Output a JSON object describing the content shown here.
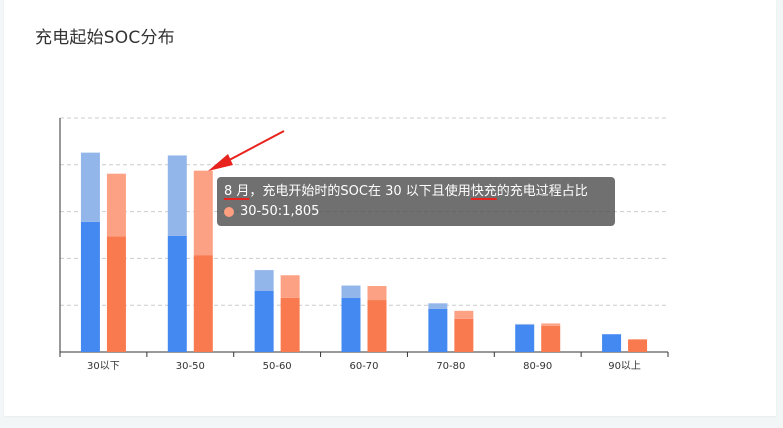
{
  "title": "充电起始SOC分布",
  "tooltip": {
    "month": "8 月",
    "text_mid": "，充电开始时的SOC在 30 以下且使用",
    "text_mark": "快充",
    "text_end": "的充电过程占比",
    "series_color": "#ff9f80",
    "category": "30-50",
    "value_text": "1,805",
    "separator": ": "
  },
  "colors": {
    "blue_base": "#4389f1",
    "blue_top": "#92b5ea",
    "orange_base": "#f97a4f",
    "orange_top": "#fca184",
    "annotation": "#e8231e"
  },
  "chart_data": {
    "type": "bar",
    "stacked": true,
    "categories": [
      "30以下",
      "30-50",
      "50-60",
      "60-70",
      "70-80",
      "80-90",
      "90以上"
    ],
    "series": [
      {
        "group": "blue",
        "layer": "base",
        "values": [
          2780,
          2480,
          1310,
          1160,
          920,
          580,
          380
        ]
      },
      {
        "group": "blue",
        "layer": "top",
        "values": [
          1480,
          1720,
          440,
          260,
          120,
          20,
          0
        ]
      },
      {
        "group": "orange",
        "layer": "base",
        "values": [
          2470,
          2070,
          1160,
          1110,
          710,
          560,
          270
        ]
      },
      {
        "group": "orange",
        "layer": "top",
        "values": [
          1340,
          1805,
          480,
          300,
          170,
          50,
          0
        ]
      }
    ],
    "ylim": [
      0,
      5000
    ],
    "gridlines": 5,
    "grid": true,
    "ytick_labels_shown": false
  }
}
